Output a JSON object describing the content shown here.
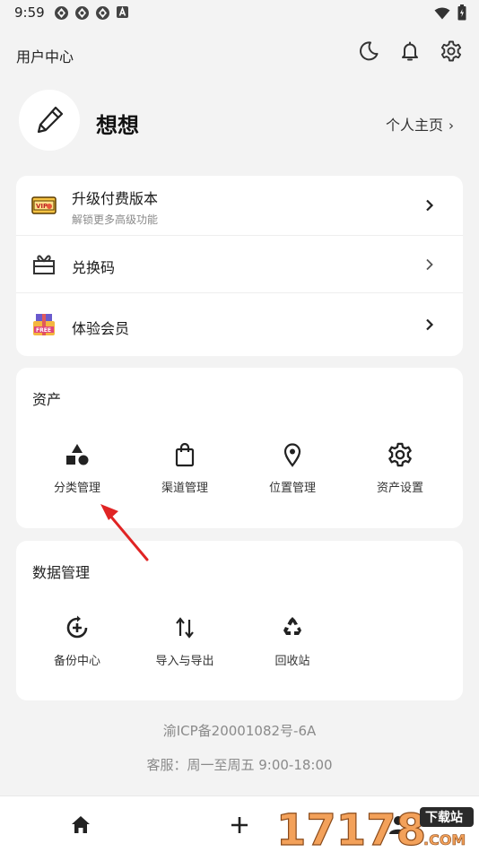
{
  "status_bar": {
    "time": "9:59"
  },
  "top_bar": {
    "title": "用户中心"
  },
  "profile": {
    "username": "想想",
    "homepage_label": "个人主页"
  },
  "vip_card": {
    "rows": [
      {
        "title": "升级付费版本",
        "subtitle": "解锁更多高级功能"
      },
      {
        "title": "兑换码"
      },
      {
        "title": "体验会员"
      }
    ]
  },
  "assets": {
    "title": "资产",
    "items": [
      {
        "label": "分类管理",
        "icon": "shapes-icon"
      },
      {
        "label": "渠道管理",
        "icon": "shopping-bag-icon"
      },
      {
        "label": "位置管理",
        "icon": "location-pin-icon"
      },
      {
        "label": "资产设置",
        "icon": "gear-icon"
      }
    ]
  },
  "data_mgmt": {
    "title": "数据管理",
    "items": [
      {
        "label": "备份中心",
        "icon": "backup-icon"
      },
      {
        "label": "导入与导出",
        "icon": "import-export-icon"
      },
      {
        "label": "回收站",
        "icon": "recycle-icon"
      }
    ]
  },
  "footer": {
    "icp": "渝ICP备20001082号-6A",
    "service": "客服：周一至周五 9:00-18:00"
  },
  "watermark": {
    "text": "17178",
    "badge": "下载站",
    "suffix": ".COM"
  },
  "colors": {
    "background": "#f3f3f3",
    "card": "#ffffff",
    "annotation": "#e02424"
  }
}
